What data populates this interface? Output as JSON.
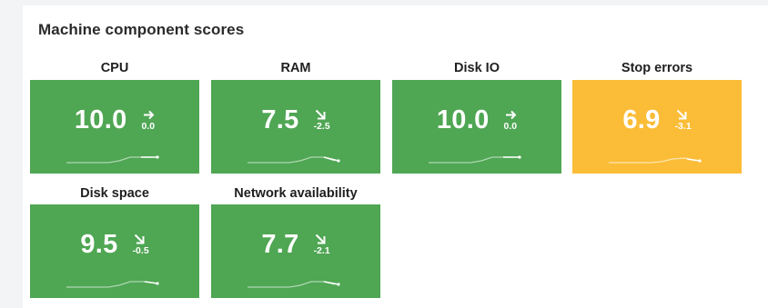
{
  "panel": {
    "title": "Machine component scores"
  },
  "colors": {
    "good": "#4fa653",
    "warning": "#fbbd37"
  },
  "tiles": [
    {
      "label": "CPU",
      "score": "10.0",
      "delta": "0.0",
      "trend_icon": "arrow-right-icon",
      "status": "good"
    },
    {
      "label": "RAM",
      "score": "7.5",
      "delta": "-2.5",
      "trend_icon": "arrow-down-right-icon",
      "status": "good"
    },
    {
      "label": "Disk IO",
      "score": "10.0",
      "delta": "0.0",
      "trend_icon": "arrow-right-icon",
      "status": "good"
    },
    {
      "label": "Stop errors",
      "score": "6.9",
      "delta": "-3.1",
      "trend_icon": "arrow-down-right-icon",
      "status": "warning"
    },
    {
      "label": "Disk space",
      "score": "9.5",
      "delta": "-0.5",
      "trend_icon": "arrow-down-right-icon",
      "status": "good"
    },
    {
      "label": "Network availability",
      "score": "7.7",
      "delta": "-2.1",
      "trend_icon": "arrow-down-right-icon",
      "status": "good"
    }
  ]
}
